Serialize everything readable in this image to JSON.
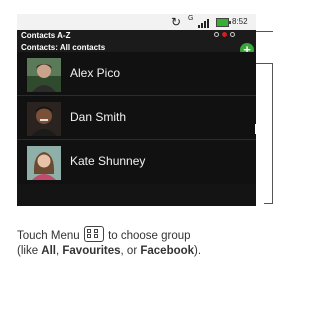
{
  "statusbar": {
    "sync_icon": "sync-icon",
    "network_label": "G",
    "signal_icon": "signal-icon",
    "battery_icon": "battery-icon",
    "time": "8:52"
  },
  "header": {
    "title": "Contacts A-Z",
    "subtitle": "Contacts: All contacts",
    "add_icon": "plus-icon",
    "page_dots": 3,
    "active_dot": 2
  },
  "contacts": [
    {
      "name": "Alex Pico"
    },
    {
      "name": "Dan Smith"
    },
    {
      "name": "Kate Shunney"
    }
  ],
  "caption": {
    "part1": "Touch Menu",
    "part2": "to choose group",
    "line2_prefix": "(like ",
    "all": "All",
    "sep1": ", ",
    "favourites": "Favourites",
    "sep2": ", or ",
    "facebook": "Facebook",
    "end": ")."
  },
  "colors": {
    "background": "#141414",
    "accent_green": "#3aa53a",
    "active_dot": "#d02020",
    "battery": "#36b030"
  }
}
